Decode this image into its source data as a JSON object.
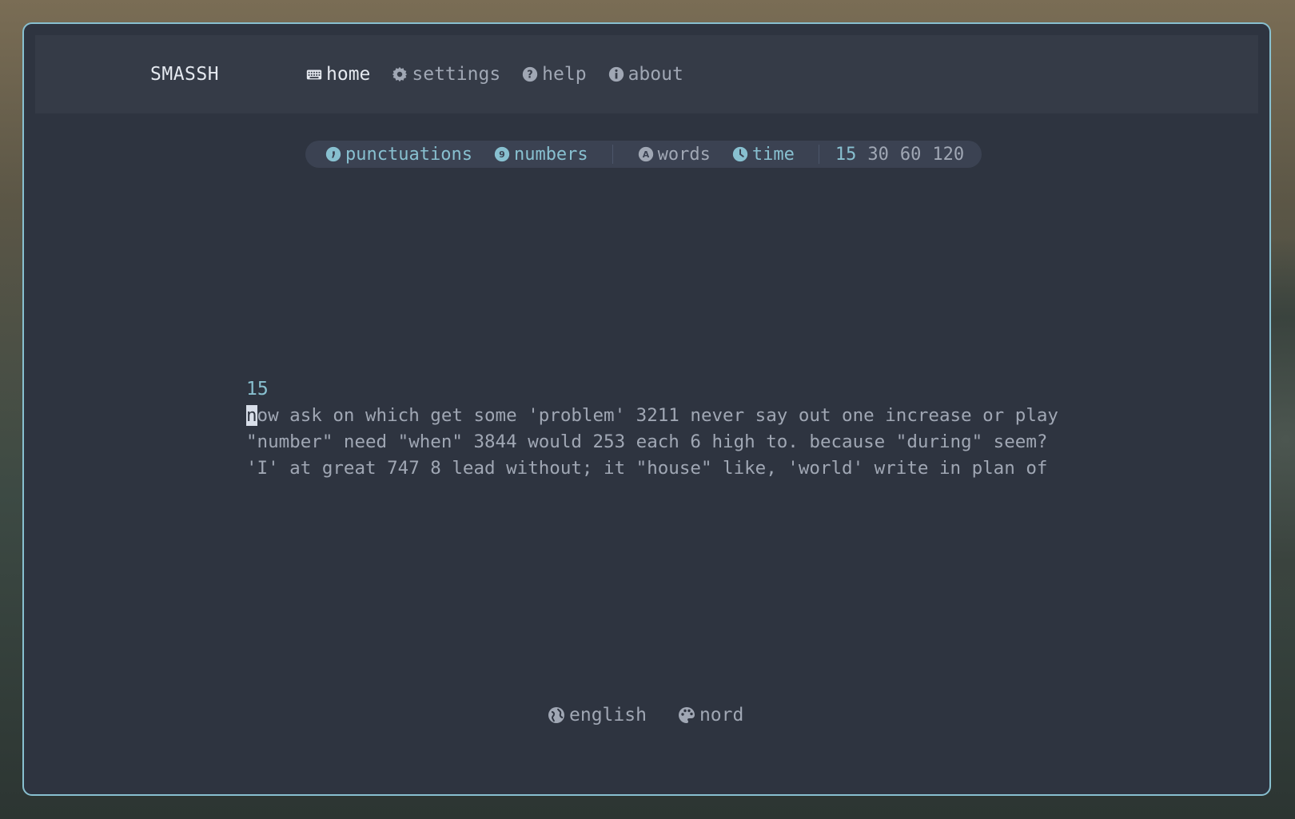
{
  "app": {
    "logo": "SMASSH"
  },
  "nav": {
    "home": "home",
    "settings": "settings",
    "help": "help",
    "about": "about"
  },
  "modes": {
    "punctuations": "punctuations",
    "numbers": "numbers",
    "words": "words",
    "time": "time",
    "durations": [
      "15",
      "30",
      "60",
      "120"
    ],
    "selected_duration": "15"
  },
  "test": {
    "counter": "15",
    "current_char": "n",
    "line1_rest": "ow ask on which get some 'problem' 3211 never say out one increase or play",
    "line2": "\"number\" need \"when\" 3844 would 253 each 6 high to. because \"during\" seem?",
    "line3": "'I' at great 747 8 lead without; it \"house\" like, 'world' write in plan of"
  },
  "footer": {
    "language": "english",
    "theme": "nord"
  },
  "colors": {
    "background": "#2e3440",
    "topbar": "#353b47",
    "accent": "#88c0d0",
    "text": "#a0a7b4",
    "text_active": "#e5e9f0"
  }
}
